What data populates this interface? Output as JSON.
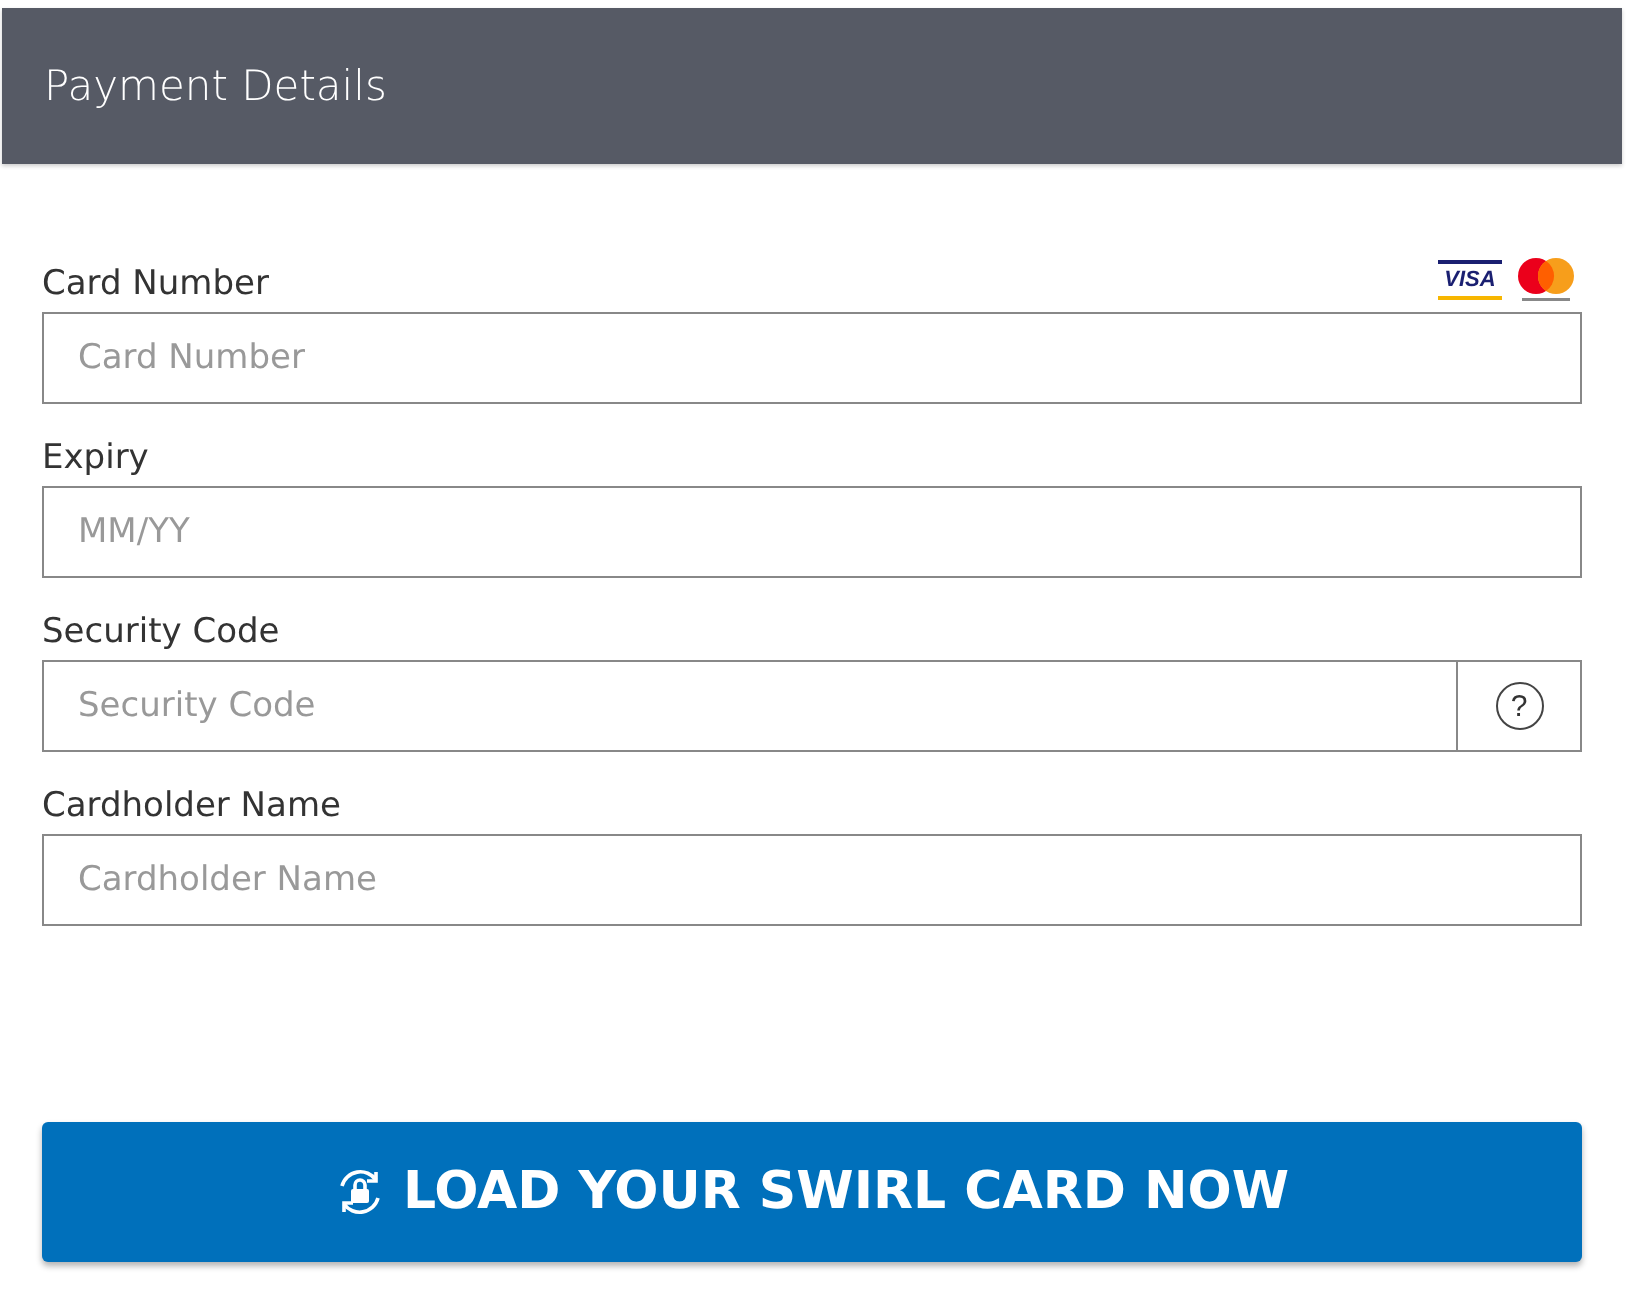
{
  "header": {
    "title": "Payment Details"
  },
  "fields": [
    {
      "kind": "cards",
      "label": "Card Number",
      "placeholder": "Card Number",
      "visa_logo": "VISA"
    },
    {
      "kind": "plain",
      "label": "Expiry",
      "placeholder": "MM/YY"
    },
    {
      "kind": "help",
      "label": "Security Code",
      "placeholder": "Security Code",
      "help": "?"
    },
    {
      "kind": "plain",
      "label": "Cardholder Name",
      "placeholder": "Cardholder Name"
    }
  ],
  "submit_button": {
    "label": "LOAD YOUR SWIRL CARD NOW"
  }
}
